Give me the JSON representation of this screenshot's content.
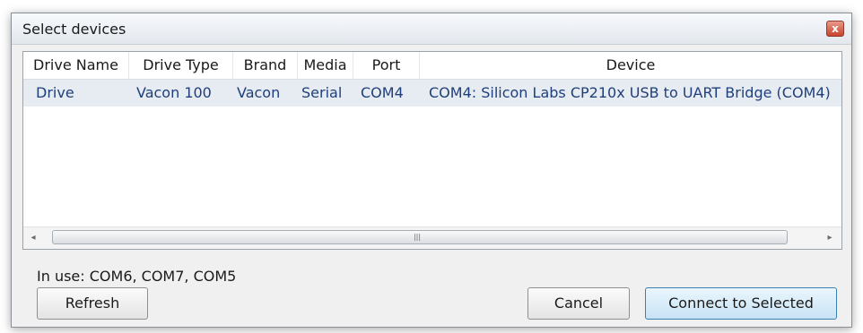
{
  "dialog": {
    "title": "Select devices",
    "close_glyph": "x"
  },
  "table": {
    "columns": [
      "Drive Name",
      "Drive Type",
      "Brand",
      "Media",
      "Port",
      "Device"
    ],
    "rows": [
      {
        "drive_name": "Drive",
        "drive_type": "Vacon 100",
        "brand": "Vacon",
        "media": "Serial",
        "port": "COM4",
        "device": "COM4: Silicon Labs CP210x USB to UART Bridge (COM4)"
      }
    ],
    "scrollbar": {
      "left_arrow": "◂",
      "right_arrow": "▸",
      "grip": "|||"
    }
  },
  "status": {
    "in_use": "In use: COM6, COM7, COM5"
  },
  "buttons": {
    "refresh": "Refresh",
    "cancel": "Cancel",
    "connect": "Connect to Selected"
  },
  "colors": {
    "selection_row": "#e7ecf2",
    "row_text": "#1f3f7a",
    "primary_button_border": "#3c7fb1",
    "close_button": "#c8432c"
  }
}
